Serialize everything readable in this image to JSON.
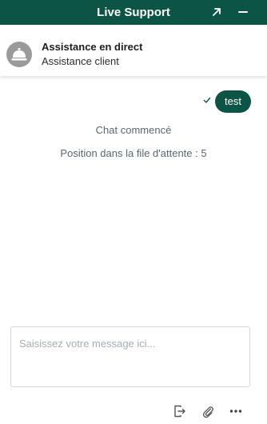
{
  "header": {
    "title": "Live Support",
    "background_color": "#0b5446",
    "popout_icon": "arrow-up-right-icon",
    "minimize_icon": "minus-icon"
  },
  "agent": {
    "name": "Assistance en direct",
    "subtitle": "Assistance client",
    "avatar_icon": "service-bell-icon"
  },
  "messages": {
    "user_message": "test",
    "delivery_status_icon": "checkmark-icon",
    "system_started": "Chat commencé",
    "system_queue": "Position dans la file d'attente : 5"
  },
  "composer": {
    "placeholder": "Saisissez votre message ici...",
    "value": ""
  },
  "toolbar": {
    "icons": [
      "exit-chat-icon",
      "paperclip-icon",
      "more-options-icon"
    ]
  }
}
